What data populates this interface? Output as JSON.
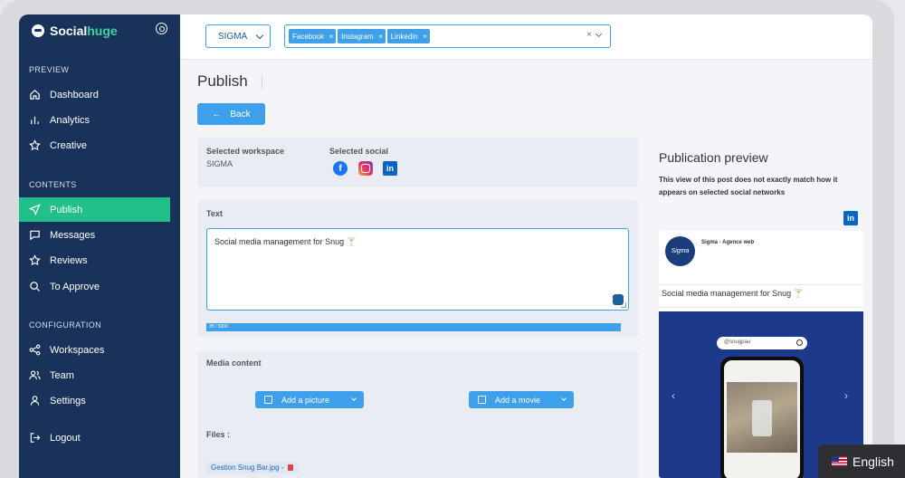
{
  "app": {
    "brand_part1": "Social",
    "brand_part2": "huge"
  },
  "sidebar": {
    "sections": [
      {
        "title": "PREVIEW",
        "items": [
          {
            "label": "Dashboard",
            "icon": "home-icon"
          },
          {
            "label": "Analytics",
            "icon": "bar-chart-icon"
          },
          {
            "label": "Creative",
            "icon": "star-icon"
          }
        ]
      },
      {
        "title": "CONTENTS",
        "items": [
          {
            "label": "Publish",
            "icon": "send-icon",
            "active": true
          },
          {
            "label": "Messages",
            "icon": "message-icon"
          },
          {
            "label": "Reviews",
            "icon": "star-icon"
          },
          {
            "label": "To Approve",
            "icon": "search-icon"
          }
        ]
      },
      {
        "title": "CONFIGURATION",
        "items": [
          {
            "label": "Workspaces",
            "icon": "share-icon"
          },
          {
            "label": "Team",
            "icon": "users-icon"
          },
          {
            "label": "Settings",
            "icon": "user-icon"
          }
        ]
      }
    ],
    "logout": "Logout",
    "active_color": "#21c08b",
    "bg_color": "#18325a"
  },
  "topbar": {
    "workspace": "SIGMA",
    "networks": [
      "Facebook",
      "Instagram",
      "Linkedin"
    ],
    "chip_remove": "×",
    "clear": "×"
  },
  "main": {
    "title": "Publish",
    "back_label": "Back",
    "back_arrow": "←",
    "selected_workspace_label": "Selected workspace",
    "selected_workspace_value": "SIGMA",
    "selected_social_label": "Selected social",
    "socials": [
      "facebook-icon",
      "instagram-icon",
      "linkedin-icon"
    ],
    "text_label": "Text",
    "text_value": "Social media management for Snug 🍸",
    "char_count": "35 / 5000",
    "char_progress": 0.007,
    "media_label": "Media content",
    "add_picture": "Add a picture",
    "add_movie": "Add a movie",
    "files_label": "Files :",
    "file_name": "Gestion Snug Bar.jpg -"
  },
  "preview": {
    "title": "Publication preview",
    "note": "This view of this post does not exactly match how it appears on selected social networks",
    "network_icon": "in",
    "avatar_text": "Sigma",
    "author": "Sigma - Agence web",
    "post_text": "Social media management for Snug 🍸",
    "search_handle": "@snugpau",
    "prev_arrow": "‹",
    "next_arrow": "›"
  },
  "language": {
    "label": "English"
  }
}
